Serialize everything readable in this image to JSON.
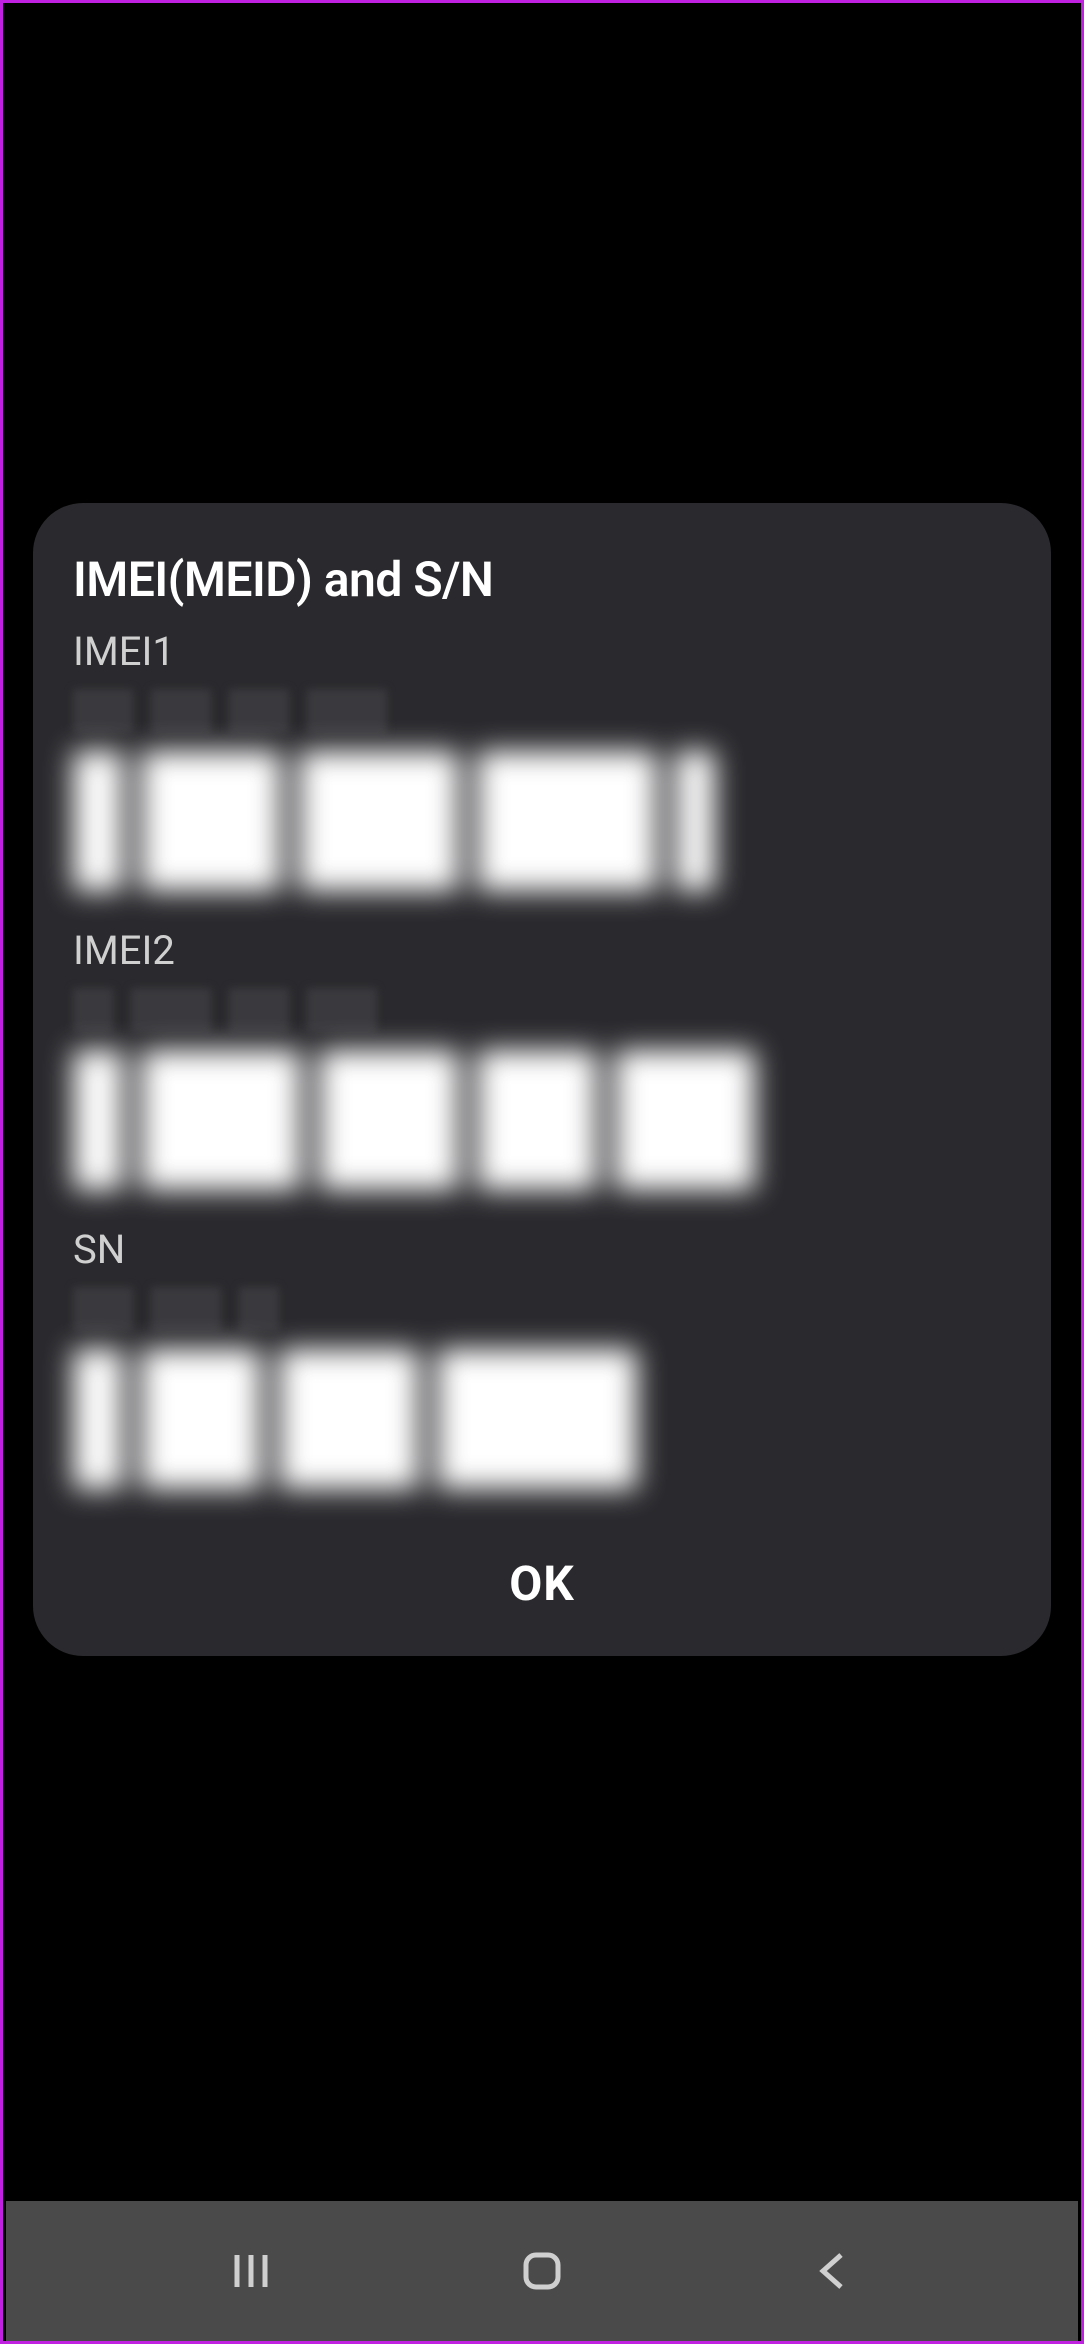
{
  "dialog": {
    "title": "IMEI(MEID) and S/N",
    "sections": [
      {
        "label": "IMEI1"
      },
      {
        "label": "IMEI2"
      },
      {
        "label": "SN"
      }
    ],
    "ok_label": "OK"
  }
}
